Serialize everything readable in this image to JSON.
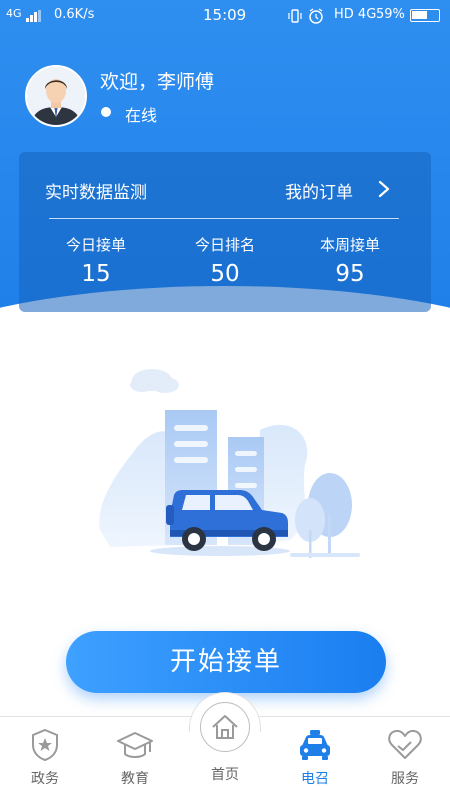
{
  "status_bar": {
    "network": "4G",
    "speed": "0.6K/s",
    "time": "15:09",
    "hd": "HD 4G",
    "battery": "59%",
    "battery_level": 0.59,
    "icons": [
      "vibrate-icon",
      "alarm-icon",
      "eye-icon"
    ]
  },
  "profile": {
    "greeting": "欢迎，李师傅",
    "status": "在线",
    "avatar_icon": "driver-avatar"
  },
  "monitor": {
    "title": "实时数据监测",
    "orders_link": "我的订单",
    "stats": [
      {
        "label": "今日接单",
        "value": "15"
      },
      {
        "label": "今日排名",
        "value": "50"
      },
      {
        "label": "本周接单",
        "value": "95"
      }
    ]
  },
  "illustration": {
    "icon": "car-city-illustration"
  },
  "start_button": {
    "label": "开始接单"
  },
  "nav": {
    "items": [
      {
        "label": "政务",
        "icon": "star-shield-icon"
      },
      {
        "label": "教育",
        "icon": "graduation-cap-icon"
      },
      {
        "label": "首页",
        "icon": "home-icon"
      },
      {
        "label": "电召",
        "icon": "taxi-icon"
      },
      {
        "label": "服务",
        "icon": "heart-icon"
      }
    ],
    "active_index": 3
  },
  "colors": {
    "primary": "#1f7fe9",
    "hero": "#2f8ff0",
    "nav_inactive": "#666666"
  }
}
